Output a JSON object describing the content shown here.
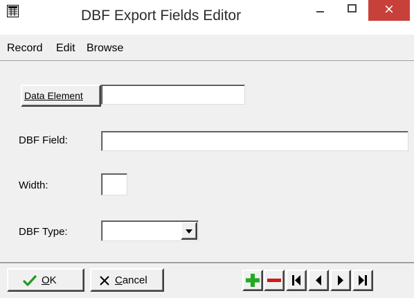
{
  "window": {
    "title": "DBF Export Fields Editor",
    "close_glyph": "×",
    "colors": {
      "close_bg": "#c7403a",
      "client_bg": "#f0f0f0"
    }
  },
  "menu": {
    "items": [
      {
        "label": "Record"
      },
      {
        "label": "Edit"
      },
      {
        "label": "Browse"
      }
    ]
  },
  "form": {
    "data_element": {
      "button_label": "Data Element",
      "value": ""
    },
    "dbf_field": {
      "label": "DBF Field:",
      "value": ""
    },
    "width": {
      "label": "Width:",
      "value": ""
    },
    "dbf_type": {
      "label": "DBF Type:",
      "value": ""
    }
  },
  "footer": {
    "ok": {
      "label_accel": "O",
      "label_rest": "K",
      "icon": "checkmark-icon",
      "color": "#1f9a1f"
    },
    "cancel": {
      "label_accel": "C",
      "label_rest": "ancel",
      "icon": "x-icon"
    },
    "nav": [
      {
        "icon": "add-icon",
        "color": "#22aa22"
      },
      {
        "icon": "delete-icon",
        "color": "#cc1a1a"
      },
      {
        "icon": "first-record-icon"
      },
      {
        "icon": "previous-record-icon"
      },
      {
        "icon": "next-record-icon"
      },
      {
        "icon": "last-record-icon"
      }
    ]
  }
}
